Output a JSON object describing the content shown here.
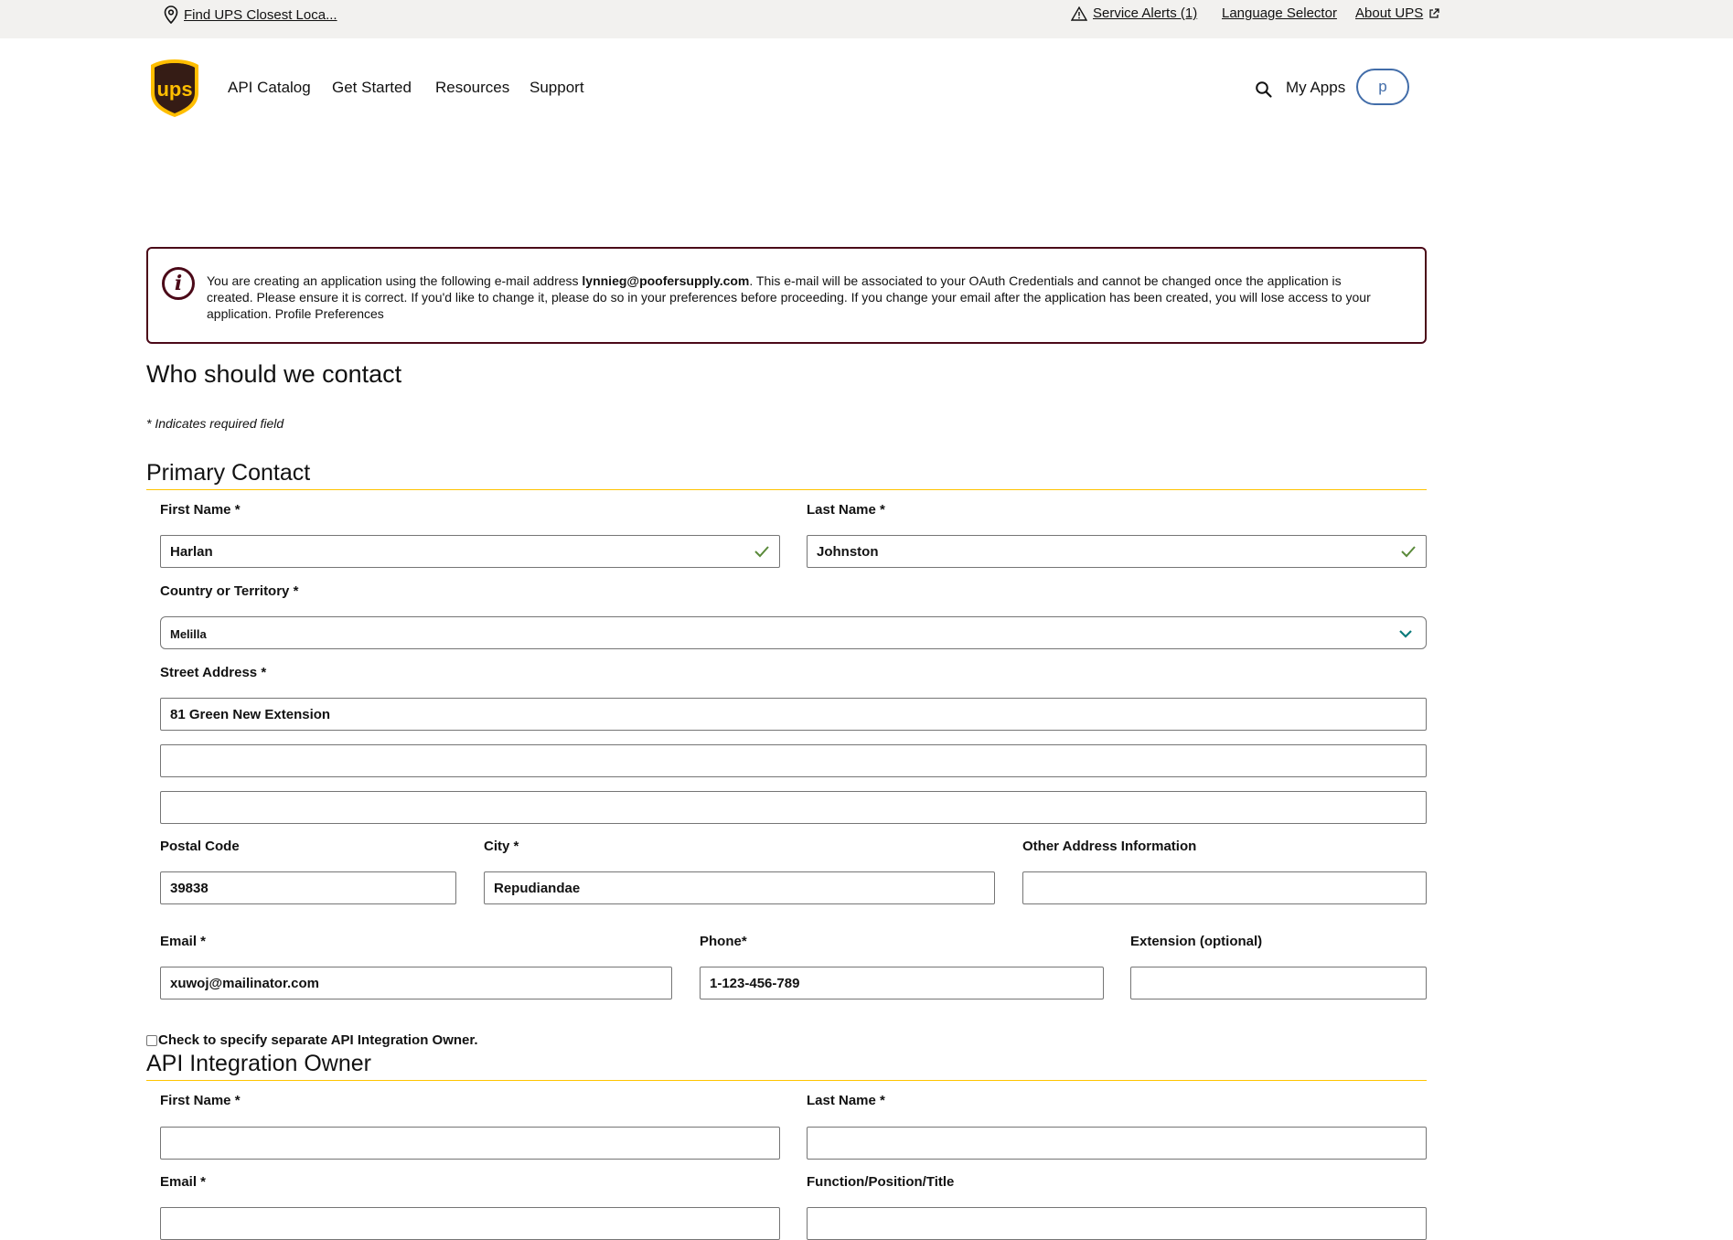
{
  "utility_bar": {
    "location_link": "Find UPS Closest Loca...",
    "service_alerts": "Service Alerts (1)",
    "language_selector": "Language Selector",
    "about_ups": "About UPS"
  },
  "header": {
    "logo_text": "ups",
    "nav": [
      "API Catalog",
      "Get Started",
      "Resources",
      "Support"
    ],
    "my_apps": "My Apps",
    "avatar_initial": "p"
  },
  "info": {
    "text_before": "You are creating an application using the following e-mail address ",
    "email": "lynnieg@poofersupply.com",
    "text_after": ". This e-mail will be associated to your OAuth Credentials and cannot be changed once the application is created. Please ensure it is correct. If you'd like to change it, please do so in your preferences before proceeding. If you change your email after the application has been created, you will lose access to your application. Profile Preferences"
  },
  "page": {
    "heading": "Who should we contact",
    "required_note": "* Indicates required field"
  },
  "primary_contact": {
    "title": "Primary Contact",
    "first_name": {
      "label": "First Name *",
      "value": "Harlan"
    },
    "last_name": {
      "label": "Last Name *",
      "value": "Johnston"
    },
    "country": {
      "label": "Country or Territory *",
      "value": "Melilla"
    },
    "street": {
      "label": "Street Address *",
      "line1": "81 Green New Extension",
      "line2": "",
      "line3": ""
    },
    "postal_code": {
      "label": "Postal Code",
      "value": "39838"
    },
    "city": {
      "label": "City *",
      "value": "Repudiandae"
    },
    "other_address": {
      "label": "Other Address Information",
      "value": ""
    },
    "email": {
      "label": "Email *",
      "value": "xuwoj@mailinator.com"
    },
    "phone": {
      "label": "Phone*",
      "value": "1-123-456-789"
    },
    "extension": {
      "label": "Extension (optional)",
      "value": ""
    }
  },
  "separate_owner_checkbox": {
    "label": "Check to specify separate API Integration Owner.",
    "checked": false
  },
  "api_owner": {
    "title": "API Integration Owner",
    "first_name": {
      "label": "First Name *",
      "value": ""
    },
    "last_name": {
      "label": "Last Name *",
      "value": ""
    },
    "email": {
      "label": "Email *",
      "value": ""
    },
    "function": {
      "label": "Function/Position/Title",
      "value": ""
    }
  },
  "colors": {
    "brand_brown": "#351c15",
    "brand_gold": "#ffbe00",
    "info_border": "#4b0918",
    "section_rule": "#ffc400",
    "valid_check": "#5a8a3a",
    "chevron": "#0b7b7b",
    "avatar_blue": "#426da9"
  }
}
